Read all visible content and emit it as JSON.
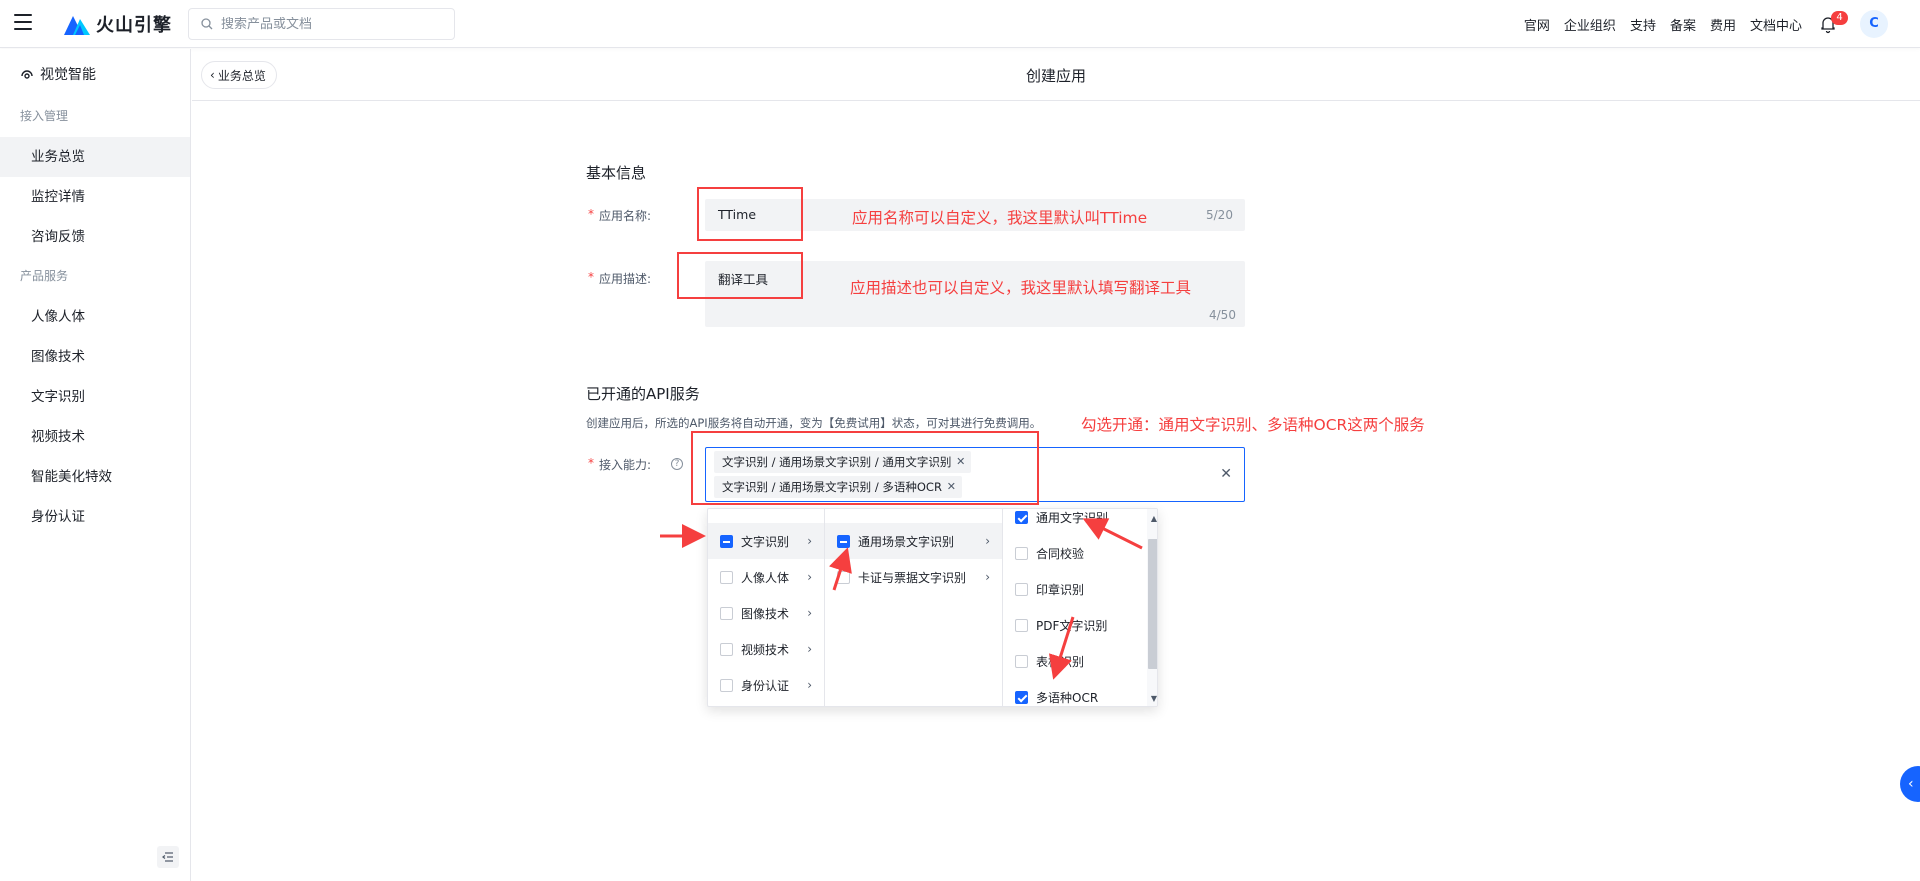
{
  "topbar": {
    "brand": "火山引擎",
    "search_placeholder": "搜索产品或文档",
    "nav": [
      "官网",
      "企业组织",
      "支持",
      "备案",
      "费用",
      "文档中心"
    ],
    "notification_count": "4",
    "avatar_initial": "C"
  },
  "sidebar": {
    "title": "视觉智能",
    "group_access": "接入管理",
    "access_items": [
      "业务总览",
      "监控详情",
      "咨询反馈"
    ],
    "group_products": "产品服务",
    "product_items": [
      "人像人体",
      "图像技术",
      "文字识别",
      "视频技术",
      "智能美化特效",
      "身份认证"
    ]
  },
  "header": {
    "back_label": "业务总览",
    "title": "创建应用"
  },
  "form": {
    "basic_title": "基本信息",
    "name_label": "应用名称:",
    "name_value": "TTime",
    "name_counter": "5/20",
    "desc_label": "应用描述:",
    "desc_value": "翻译工具",
    "desc_counter": "4/50",
    "api_title": "已开通的API服务",
    "api_hint": "创建应用后，所选的API服务将自动开通，变为【免费试用】状态，可对其进行免费调用。",
    "ability_label": "接入能力:",
    "tags": [
      "文字识别 / 通用场景文字识别 / 通用文字识别",
      "文字识别 / 通用场景文字识别 / 多语种OCR"
    ]
  },
  "cascader": {
    "col1": [
      "文字识别",
      "人像人体",
      "图像技术",
      "视频技术",
      "身份认证"
    ],
    "col2": [
      "通用场景文字识别",
      "卡证与票据文字识别"
    ],
    "col3": [
      {
        "label": "通用文字识别",
        "checked": true
      },
      {
        "label": "合同校验",
        "checked": false
      },
      {
        "label": "印章识别",
        "checked": false
      },
      {
        "label": "PDF文字识别",
        "checked": false
      },
      {
        "label": "表格识别",
        "checked": false
      },
      {
        "label": "多语种OCR",
        "checked": true
      }
    ]
  },
  "annotations": {
    "name_note": "应用名称可以自定义，我这里默认叫TTime",
    "desc_note": "应用描述也可以自定义，我这里默认填写翻译工具",
    "api_note": "勾选开通：通用文字识别、多语种OCR这两个服务"
  },
  "colors": {
    "primary": "#1664ff",
    "annotation_red": "#f53f3f"
  }
}
